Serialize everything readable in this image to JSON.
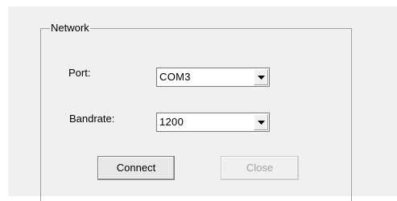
{
  "network_group": {
    "title": "Network",
    "port": {
      "label": "Port:",
      "value": "COM3"
    },
    "baudrate": {
      "label": "Bandrate:",
      "value": "1200"
    },
    "buttons": {
      "connect": "Connect",
      "close": "Close"
    }
  },
  "colors": {
    "panel_background": "#f0f0f0",
    "groupbox_border": "#a0a0a0",
    "disabled_text": "#a0a0a0"
  },
  "states": {
    "close_button_enabled": false
  }
}
